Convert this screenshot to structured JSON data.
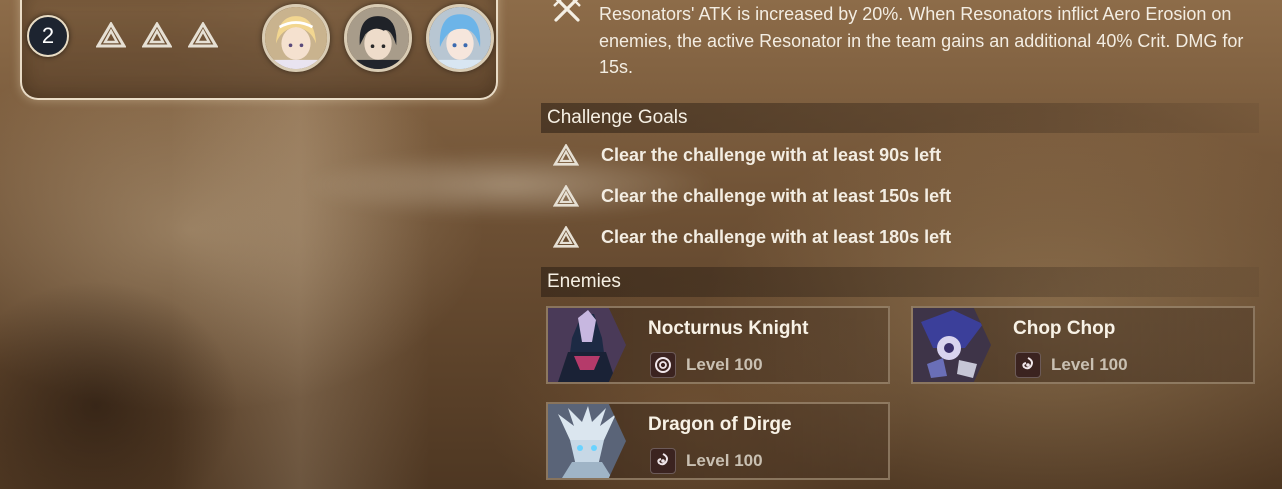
{
  "team": {
    "number": "2",
    "goal_icons": [
      "triangle-goal-icon",
      "triangle-goal-icon",
      "triangle-goal-icon"
    ],
    "members": [
      {
        "name_icon": "blonde-character-avatar"
      },
      {
        "name_icon": "dark-hair-character-avatar"
      },
      {
        "name_icon": "blue-hair-character-avatar"
      }
    ]
  },
  "buff": {
    "icon": "crossed-swords-icon",
    "text": "Resonators' ATK is increased by 20%. When Resonators inflict Aero Erosion on enemies, the active Resonator in the team gains an additional 40% Crit. DMG for 15s."
  },
  "challenge_goals": {
    "title": "Challenge Goals",
    "items": [
      {
        "icon": "triangle-goal-icon",
        "text": "Clear the challenge with at least 90s left"
      },
      {
        "icon": "triangle-goal-icon",
        "text": "Clear the challenge with at least 150s left"
      },
      {
        "icon": "triangle-goal-icon",
        "text": "Clear the challenge with at least 180s left"
      }
    ]
  },
  "enemies": {
    "title": "Enemies",
    "items": [
      {
        "name": "Nocturnus Knight",
        "level": "Level 100",
        "element_icon": "havoc-element-icon"
      },
      {
        "name": "Chop Chop",
        "level": "Level 100",
        "element_icon": "havoc-element-icon"
      },
      {
        "name": "Dragon of Dirge",
        "level": "Level 100",
        "element_icon": "havoc-element-icon"
      }
    ]
  },
  "colors": {
    "text": "#f3ede2",
    "level_text": "#c9c0b2",
    "card_border": "#aa967d",
    "team_badge": "#1d2430"
  }
}
